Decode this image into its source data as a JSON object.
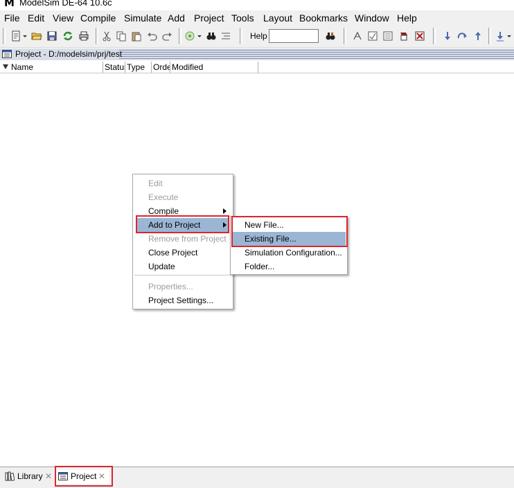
{
  "window": {
    "app_icon": "M",
    "title": "ModelSim DE-64 10.6c"
  },
  "menubar": {
    "items": [
      "File",
      "Edit",
      "View",
      "Compile",
      "Simulate",
      "Add",
      "Project",
      "Tools",
      "Layout",
      "Bookmarks",
      "Window",
      "Help"
    ]
  },
  "toolbar": {
    "help_label": "Help",
    "help_input_value": ""
  },
  "panel": {
    "title": "Project - D:/modelsim/prj/test",
    "columns": [
      "Name",
      "Status",
      "Type",
      "Order",
      "Modified"
    ]
  },
  "context_menu": {
    "items": [
      {
        "label": "Edit",
        "enabled": false
      },
      {
        "label": "Execute",
        "enabled": false
      },
      {
        "label": "Compile",
        "enabled": true,
        "submenu": true
      },
      {
        "label": "Add to Project",
        "enabled": true,
        "submenu": true,
        "highlighted": true
      },
      {
        "label": "Remove from Project",
        "enabled": false
      },
      {
        "label": "Close Project",
        "enabled": true
      },
      {
        "label": "Update",
        "enabled": true
      },
      {
        "label": "Properties...",
        "enabled": false
      },
      {
        "label": "Project Settings...",
        "enabled": true
      }
    ]
  },
  "submenu": {
    "items": [
      {
        "label": "New File..."
      },
      {
        "label": "Existing File...",
        "highlighted": true
      },
      {
        "label": "Simulation Configuration..."
      },
      {
        "label": "Folder..."
      }
    ]
  },
  "tabs": [
    {
      "label": "Library",
      "icon": "library-icon",
      "active": false
    },
    {
      "label": "Project",
      "icon": "project-icon",
      "active": true
    }
  ],
  "colors": {
    "highlight": "#9bb6d4",
    "annotation_red": "#d9262e",
    "disabled_text": "#9b9b9b"
  }
}
